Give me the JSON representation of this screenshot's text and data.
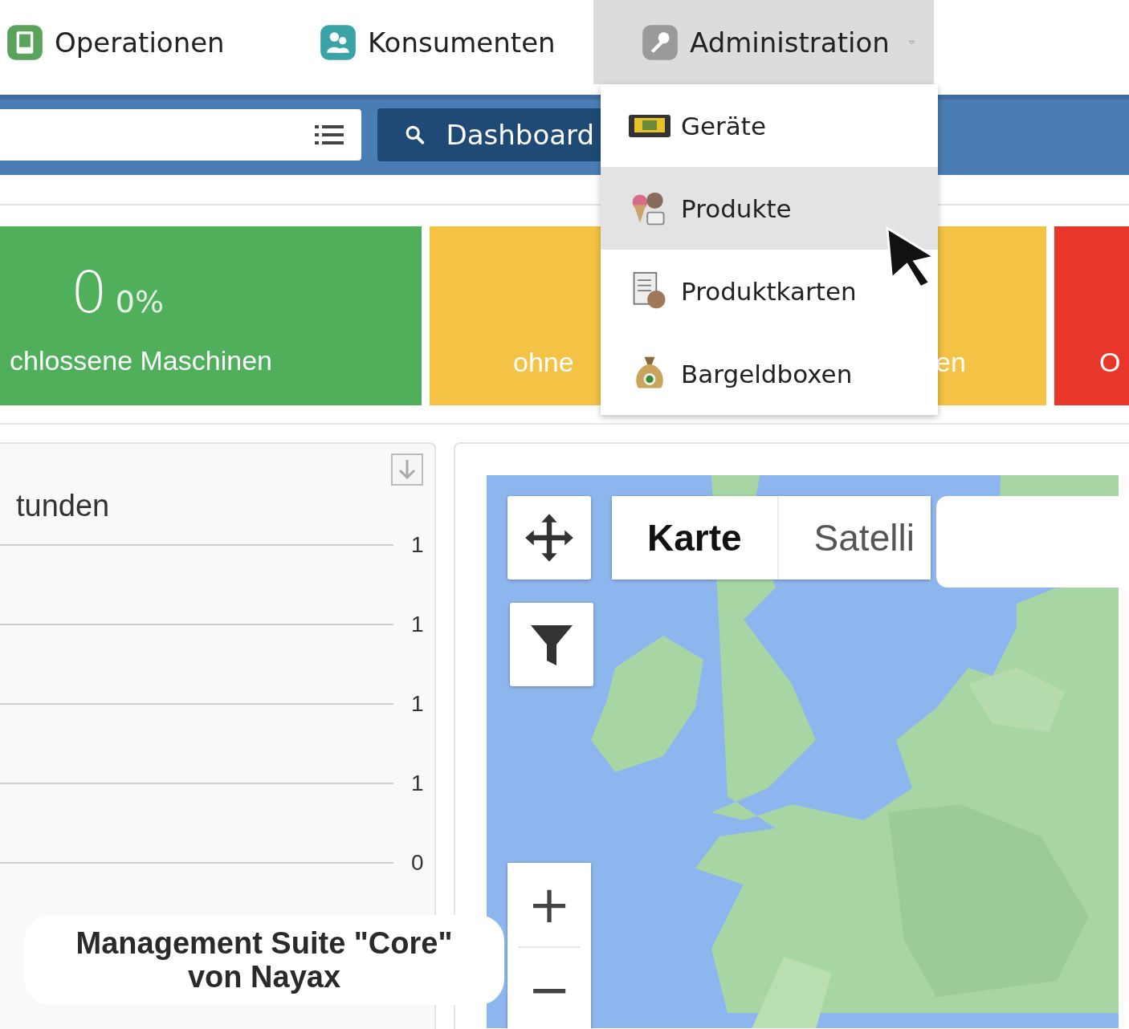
{
  "nav": {
    "items": [
      {
        "label": "Operationen",
        "kind": "operations",
        "selected": false
      },
      {
        "label": "Konsumenten",
        "kind": "consumers",
        "selected": false
      },
      {
        "label": "Administration",
        "kind": "admin",
        "selected": true
      }
    ]
  },
  "toolbar": {
    "search_button": "Dashboard"
  },
  "dropdown": {
    "items": [
      {
        "label": "Geräte",
        "kind": "device",
        "selected": false
      },
      {
        "label": "Produkte",
        "kind": "products",
        "selected": true
      },
      {
        "label": "Produktkarten",
        "kind": "cards",
        "selected": false
      },
      {
        "label": "Bargeldboxen",
        "kind": "moneybag",
        "selected": false
      }
    ]
  },
  "tiles": [
    {
      "color": "#4faf5b",
      "value": "0",
      "percent": "0%",
      "label": "chlossene Maschinen"
    },
    {
      "color": "#f4c244",
      "label": "ohne",
      "label_end": "en"
    },
    {
      "color": "#e8372a",
      "label": "O"
    }
  ],
  "chart_panel": {
    "title": "tunden",
    "y_labels": [
      "1",
      "1",
      "1",
      "1",
      "0"
    ]
  },
  "map": {
    "map_types": [
      {
        "label": "Karte",
        "selected": true
      },
      {
        "label": "Satelli",
        "selected": false
      }
    ],
    "zoom_in": "+",
    "zoom_out": "−"
  },
  "caption": {
    "line1": "Management Suite \"Core\"",
    "line2": "von Nayax"
  }
}
